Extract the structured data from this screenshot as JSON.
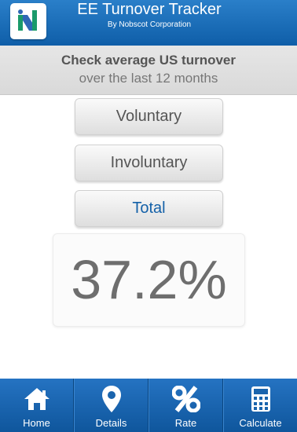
{
  "header": {
    "title": "EE Turnover Tracker",
    "subtitle": "By Nobscot Corporation"
  },
  "banner": {
    "line1": "Check average US turnover",
    "line2": "over the last 12 months"
  },
  "options": [
    {
      "label": "Voluntary",
      "active": false
    },
    {
      "label": "Involuntary",
      "active": false
    },
    {
      "label": "Total",
      "active": true
    }
  ],
  "result": {
    "value": "37.2%"
  },
  "tabs": [
    {
      "label": "Home",
      "icon": "home-icon"
    },
    {
      "label": "Details",
      "icon": "map-pin-icon"
    },
    {
      "label": "Rate",
      "icon": "percent-icon"
    },
    {
      "label": "Calculate",
      "icon": "calculator-icon"
    }
  ],
  "colors": {
    "brand_blue": "#1a6bb8",
    "banner_gray": "#dddddd",
    "active_text": "#1461a8"
  }
}
